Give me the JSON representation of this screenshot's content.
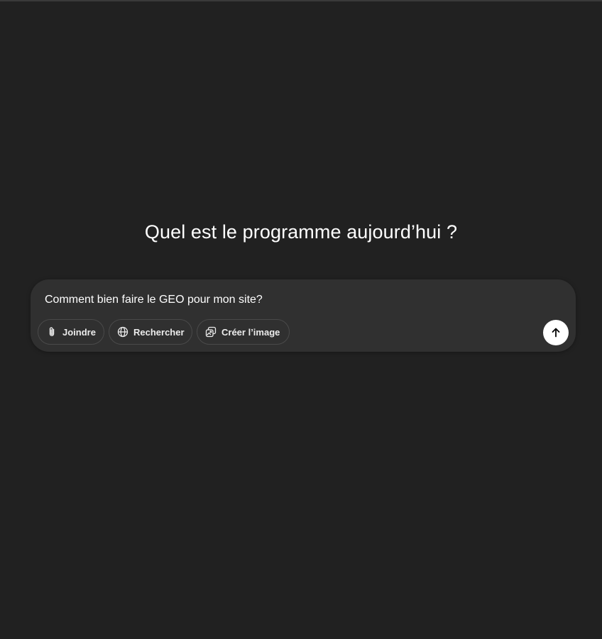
{
  "main": {
    "heading": "Quel est le programme aujourd’hui ?"
  },
  "composer": {
    "input_value": "Comment bien faire le GEO pour mon site?",
    "tools": [
      {
        "label": "Joindre",
        "icon": "paperclip-icon"
      },
      {
        "label": "Rechercher",
        "icon": "globe-icon"
      },
      {
        "label": "Créer l’image",
        "icon": "image-icon"
      }
    ],
    "send_icon": "arrow-up-icon"
  },
  "colors": {
    "background": "#212121",
    "composer": "#303030",
    "send_button": "#ffffff"
  }
}
